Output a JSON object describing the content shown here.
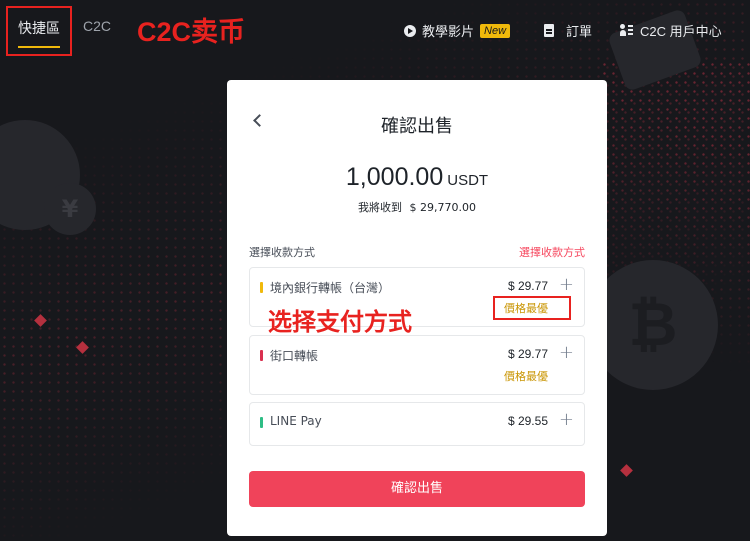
{
  "nav": {
    "tab_quick": "快捷區",
    "tab_c2c": "C2C",
    "tutorial_label": "教學影片",
    "new_badge": "New",
    "orders_label": "訂單",
    "user_center_label": "C2C 用戶中心"
  },
  "annotations": {
    "title": "C2C卖币",
    "select_payment": "选择支付方式"
  },
  "card": {
    "title": "確認出售",
    "amount": "1,000.00",
    "amount_unit": "USDT",
    "receive_label": "我將收到",
    "receive_value": "$  29,770.00",
    "section_label": "選擇收款方式",
    "section_action": "選擇收款方式",
    "methods": [
      {
        "name": "境內銀行轉帳（台灣）",
        "price": "$  29.77",
        "tag": "價格最優",
        "color": "#f0b90b"
      },
      {
        "name": "街口轉帳",
        "price": "$  29.77",
        "tag": "價格最優",
        "color": "#d9304f"
      },
      {
        "name": "LINE Pay",
        "price": "$  29.55",
        "tag": "",
        "color": "#2ebd85"
      }
    ],
    "confirm_button": "確認出售"
  },
  "colors": {
    "accent": "#f0b90b",
    "primary_button": "#f0435a",
    "annotation": "#e8221f",
    "tag": "#c99400"
  }
}
